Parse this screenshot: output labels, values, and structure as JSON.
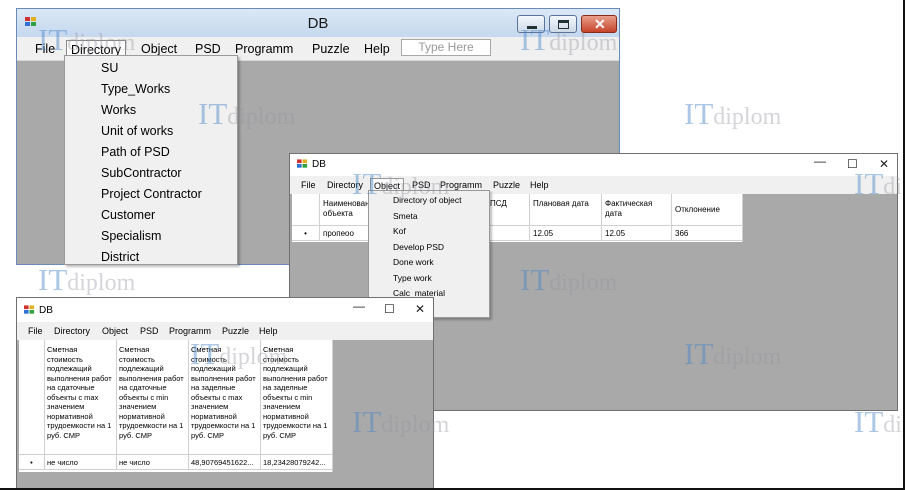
{
  "window1": {
    "title": "DB",
    "menu": [
      "File",
      "Directory",
      "Object",
      "PSD",
      "Programm",
      "Puzzle",
      "Help"
    ],
    "type_here": "Type Here",
    "directory_menu": [
      "SU",
      "Type_Works",
      "Works",
      "Unit of works",
      "Path of PSD",
      "SubContractor",
      "Project Contractor",
      "Customer",
      "Specialism",
      "District"
    ]
  },
  "window2": {
    "title": "DB",
    "menu": [
      "File",
      "Directory",
      "Object",
      "PSD",
      "Programm",
      "Puzzle",
      "Help"
    ],
    "columns": [
      "Наименование объекта",
      "ПСД",
      "Плановая дата",
      "Фактическая дата",
      "Отклонение"
    ],
    "row": {
      "marker": "•",
      "cells": [
        "пропеоо",
        "",
        "12.05",
        "12.05",
        "366"
      ]
    },
    "object_menu": [
      "Directory of object",
      "Smeta",
      "Kof",
      "Develop PSD",
      "Done work",
      "Type work",
      "Calc_material"
    ]
  },
  "window3": {
    "title": "DB",
    "menu": [
      "File",
      "Directory",
      "Object",
      "PSD",
      "Programm",
      "Puzzle",
      "Help"
    ],
    "columns": [
      "Сметная стоимость подлежащий выполнения работ на сдаточные объекты с max значением нормативной трудоемкости на 1 руб. СМР",
      "Сметная стоимость подлежащий выполнения работ на сдаточные объекты с min значением нормативной трудоемкости на 1 руб. СМР",
      "Сметная стоимость подлежащий выполнения работ на заделные объекты с max значением нормативной трудоемкости на 1 руб. СМР",
      "Сметная стоимость подлежащий выполнения работ на заделные объекты с min значением нормативной трудоемкости на 1 руб. СМР"
    ],
    "row": {
      "marker": "•",
      "cells": [
        "не число",
        "не число",
        "48,90769451622...",
        "18,23428079242..."
      ]
    }
  },
  "watermark": {
    "it": "IT",
    "diplom": "diplom"
  }
}
